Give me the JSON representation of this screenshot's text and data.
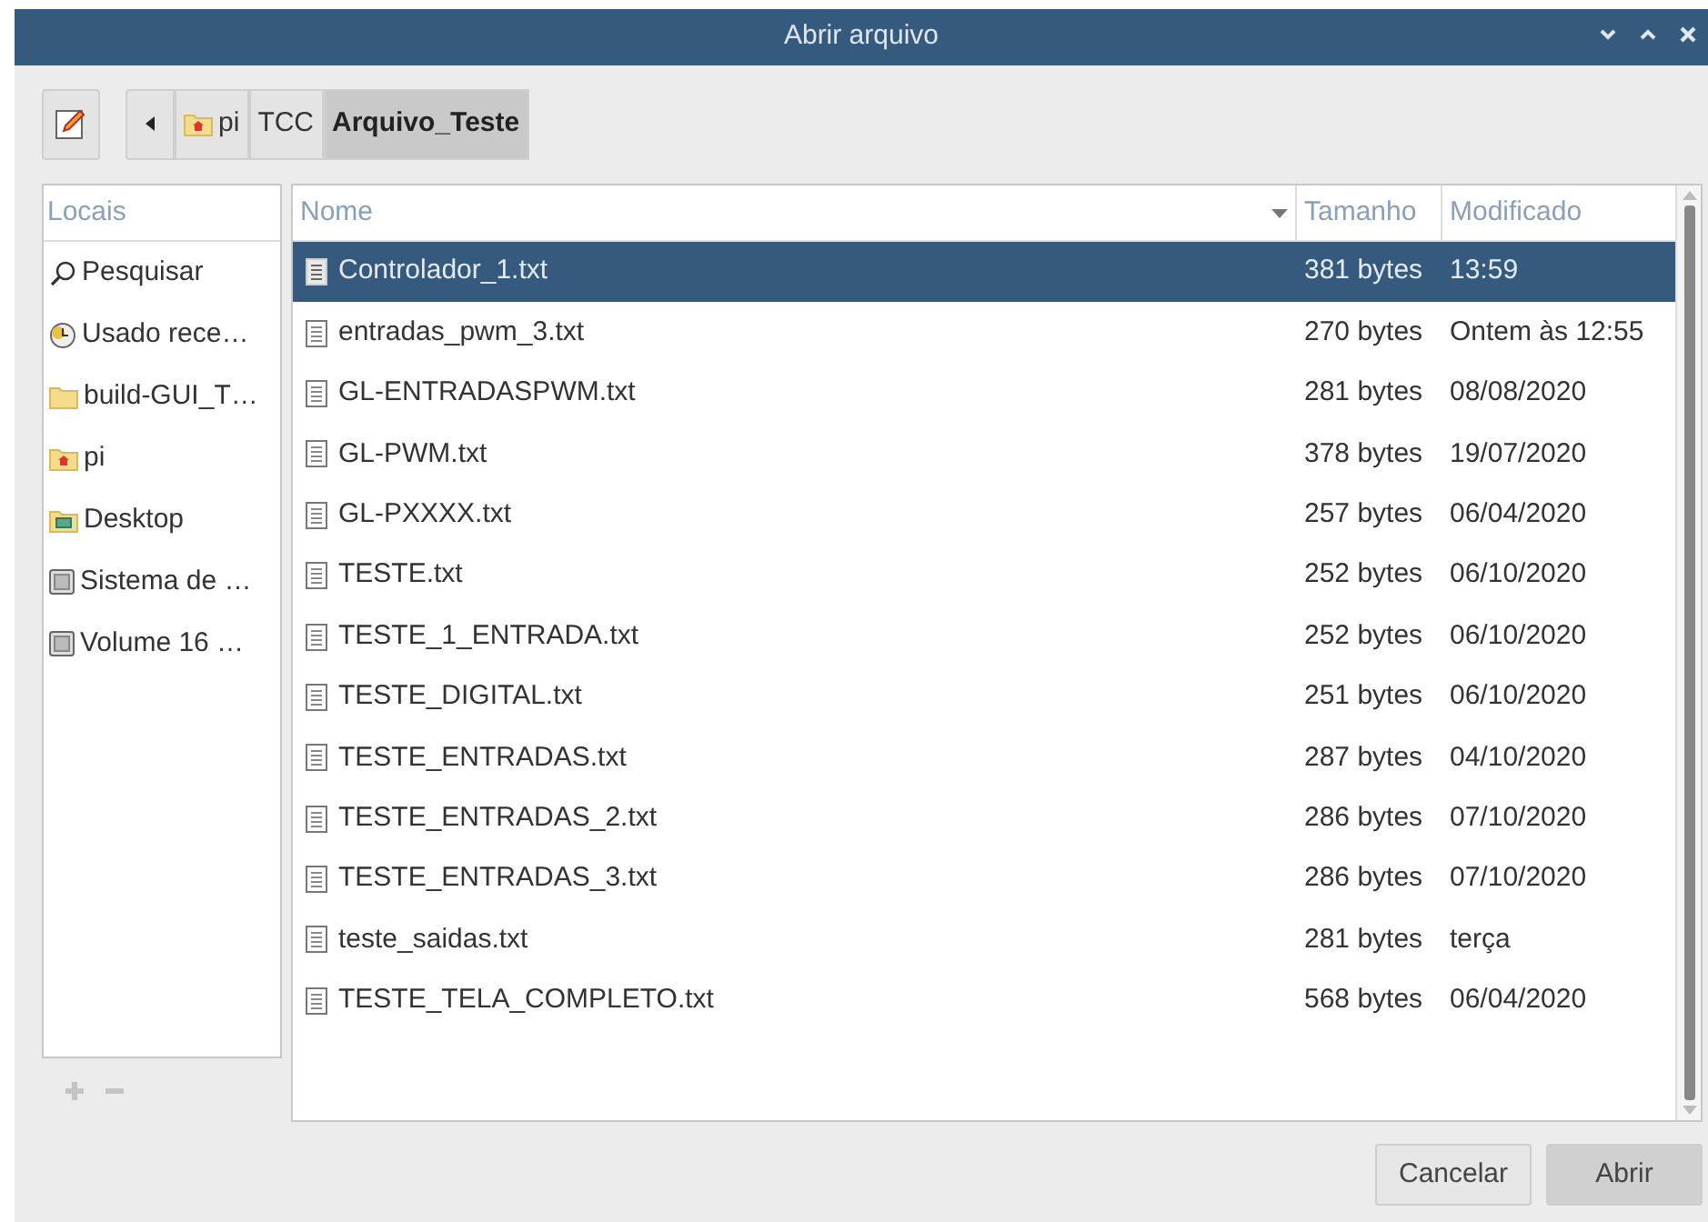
{
  "window": {
    "title": "Abrir arquivo"
  },
  "path_bar": [
    {
      "label": "pi",
      "kind": "home",
      "selected": false
    },
    {
      "label": "TCC",
      "kind": "plain",
      "selected": false
    },
    {
      "label": "Arquivo_Teste",
      "kind": "plain",
      "selected": true
    }
  ],
  "places": {
    "header": "Locais",
    "items": [
      {
        "label": "Pesquisar",
        "kind": "search"
      },
      {
        "label": "Usado rece…",
        "kind": "recent"
      },
      {
        "label": "build-GUI_T…",
        "kind": "folder"
      },
      {
        "label": "pi",
        "kind": "home"
      },
      {
        "label": "Desktop",
        "kind": "desktop"
      },
      {
        "label": "Sistema de …",
        "kind": "drive"
      },
      {
        "label": "Volume 16 …",
        "kind": "drive"
      }
    ]
  },
  "table": {
    "columns": [
      "Nome",
      "Tamanho",
      "Modificado"
    ],
    "rows": [
      {
        "name": "Controlador_1.txt",
        "size": "381 bytes",
        "modified": "13:59",
        "selected": true
      },
      {
        "name": "entradas_pwm_3.txt",
        "size": "270 bytes",
        "modified": "Ontem às 12:55",
        "selected": false
      },
      {
        "name": "GL-ENTRADASPWM.txt",
        "size": "281 bytes",
        "modified": "08/08/2020",
        "selected": false
      },
      {
        "name": "GL-PWM.txt",
        "size": "378 bytes",
        "modified": "19/07/2020",
        "selected": false
      },
      {
        "name": "GL-PXXXX.txt",
        "size": "257 bytes",
        "modified": "06/04/2020",
        "selected": false
      },
      {
        "name": "TESTE.txt",
        "size": "252 bytes",
        "modified": "06/10/2020",
        "selected": false
      },
      {
        "name": "TESTE_1_ENTRADA.txt",
        "size": "252 bytes",
        "modified": "06/10/2020",
        "selected": false
      },
      {
        "name": "TESTE_DIGITAL.txt",
        "size": "251 bytes",
        "modified": "06/10/2020",
        "selected": false
      },
      {
        "name": "TESTE_ENTRADAS.txt",
        "size": "287 bytes",
        "modified": "04/10/2020",
        "selected": false
      },
      {
        "name": "TESTE_ENTRADAS_2.txt",
        "size": "286 bytes",
        "modified": "07/10/2020",
        "selected": false
      },
      {
        "name": "TESTE_ENTRADAS_3.txt",
        "size": "286 bytes",
        "modified": "07/10/2020",
        "selected": false
      },
      {
        "name": "teste_saidas.txt",
        "size": "281 bytes",
        "modified": "terça",
        "selected": false
      },
      {
        "name": "TESTE_TELA_COMPLETO.txt",
        "size": "568 bytes",
        "modified": "06/04/2020",
        "selected": false
      }
    ]
  },
  "buttons": [
    {
      "label": "Cancelar",
      "kind": "normal"
    },
    {
      "label": "Abrir",
      "kind": "default"
    }
  ]
}
